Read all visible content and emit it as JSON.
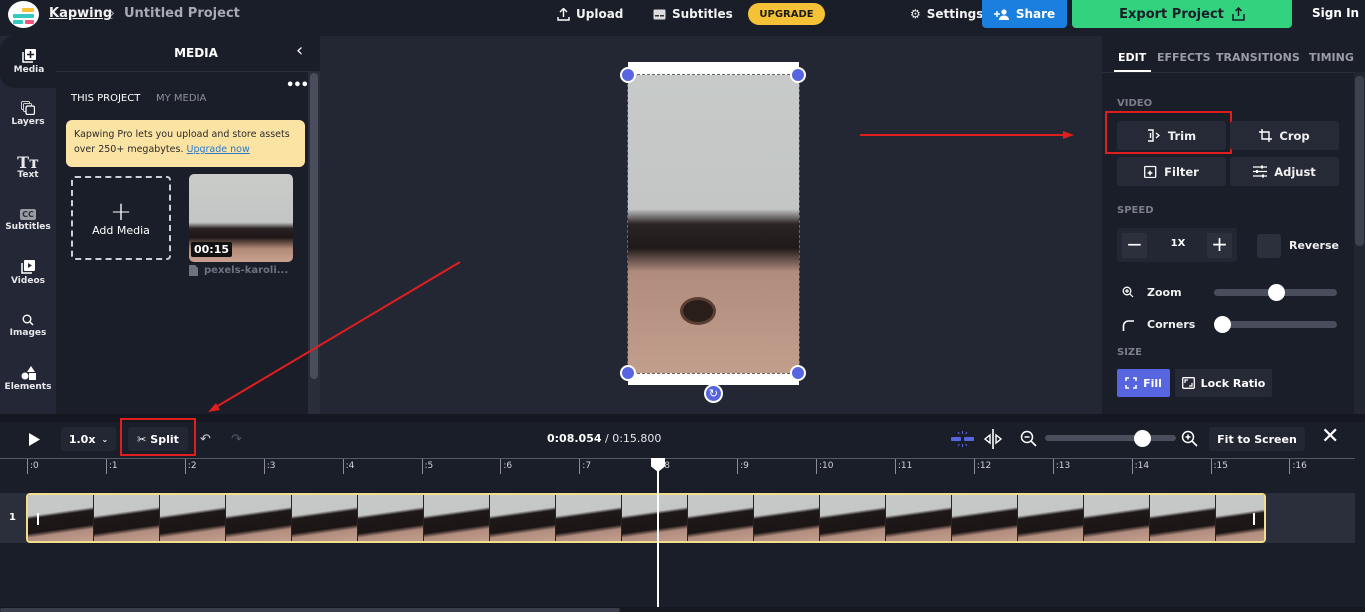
{
  "header": {
    "brand": "Kapwing",
    "breadcrumb_separator": "›",
    "project_title": "Untitled Project",
    "upload_label": "Upload",
    "subtitles_label": "Subtitles",
    "upgrade_label": "UPGRADE",
    "settings_label": "Settings",
    "share_label": "Share",
    "export_label": "Export Project",
    "signin_label": "Sign In",
    "colors": {
      "upgrade": "#f5c237",
      "share": "#1b7fe0",
      "export": "#33d27e"
    }
  },
  "sidebar": {
    "items": [
      {
        "label": "Media",
        "icon": "media-add-icon",
        "active": true
      },
      {
        "label": "Layers",
        "icon": "layers-icon"
      },
      {
        "label": "Text",
        "icon": "text-icon"
      },
      {
        "label": "Subtitles",
        "icon": "cc-icon"
      },
      {
        "label": "Videos",
        "icon": "video-library-icon"
      },
      {
        "label": "Images",
        "icon": "search-icon"
      },
      {
        "label": "Elements",
        "icon": "shapes-icon"
      }
    ]
  },
  "media_panel": {
    "title": "MEDIA",
    "collapse_icon": "‹",
    "more_icon": "•••",
    "tabs": [
      {
        "label": "THIS PROJECT",
        "active": true
      },
      {
        "label": "MY MEDIA",
        "active": false
      }
    ],
    "promo_text": "Kapwing Pro lets you upload and store assets over 250+ megabytes.",
    "promo_link": "Upgrade now",
    "add_media_label": "Add Media",
    "items": [
      {
        "duration": "00:15",
        "name": "pexels-karoli..."
      }
    ]
  },
  "properties": {
    "tabs": [
      "EDIT",
      "EFFECTS",
      "TRANSITIONS",
      "TIMING"
    ],
    "active_tab": "EDIT",
    "video_section": "VIDEO",
    "video_buttons": [
      "Trim",
      "Crop",
      "Filter",
      "Adjust"
    ],
    "speed_section": "SPEED",
    "speed_value": "1X",
    "reverse_label": "Reverse",
    "reverse_checked": false,
    "zoom_label": "Zoom",
    "zoom_value": 0.5,
    "corners_label": "Corners",
    "corners_value": 0.0,
    "size_section": "SIZE",
    "fill_label": "Fill",
    "lock_ratio_label": "Lock Ratio"
  },
  "timeline": {
    "playback_rate": "1.0x",
    "split_label": "Split",
    "current_time": "0:08.054",
    "total_time": "0:15.800",
    "time_separator": " / ",
    "zoom_value": 0.74,
    "fit_label": "Fit to Screen",
    "ruler_ticks": [
      ":0",
      ":1",
      ":2",
      ":3",
      ":4",
      ":5",
      ":6",
      ":7",
      ":8",
      ":9",
      ":10",
      ":11",
      ":12",
      ":13",
      ":14",
      ":15",
      ":16"
    ],
    "tracks": [
      {
        "label": "1"
      }
    ]
  }
}
